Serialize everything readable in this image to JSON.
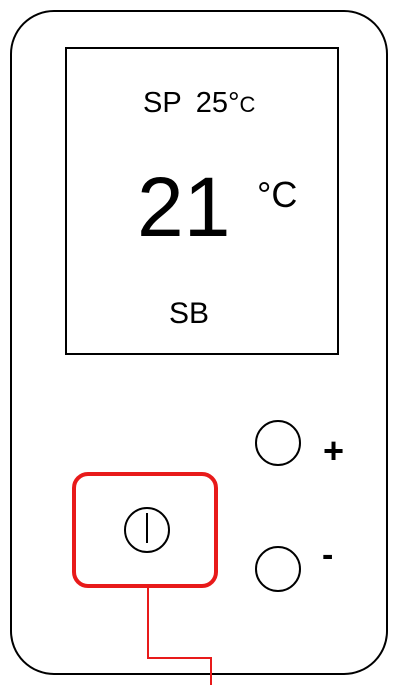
{
  "display": {
    "setpoint_label": "SP",
    "setpoint_value": "25°",
    "setpoint_unit": "C",
    "current_temperature": "21",
    "current_unit": "°C",
    "mode": "SB"
  },
  "buttons": {
    "plus_label": "+",
    "minus_label": "-"
  },
  "colors": {
    "highlight": "#e81a1a",
    "outline": "#000000"
  },
  "icons": {
    "power": "power-icon"
  }
}
